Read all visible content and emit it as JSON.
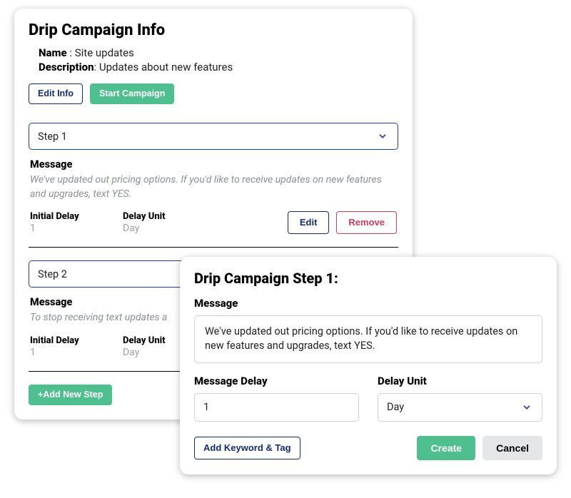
{
  "info": {
    "title": "Drip Campaign Info",
    "name_label": "Name ",
    "name_sep": ": ",
    "name_value": "Site updates",
    "desc_label": "Description",
    "desc_sep": ": ",
    "desc_value": "Updates about new features",
    "edit_info_label": "Edit Info",
    "start_campaign_label": "Start Campaign"
  },
  "steps": [
    {
      "select_label": "Step 1",
      "message_heading": "Message",
      "message_body": "We've updated out pricing options. If you'd like to receive updates on new features and upgrades, text YES.",
      "initial_delay_label": "Initial Delay",
      "initial_delay_value": "1",
      "delay_unit_label": "Delay Unit",
      "delay_unit_value": "Day",
      "edit_label": "Edit",
      "remove_label": "Remove"
    },
    {
      "select_label": "Step 2",
      "message_heading": "Message",
      "message_body": "To stop receiving text updates a",
      "initial_delay_label": "Initial Delay",
      "initial_delay_value": "1",
      "delay_unit_label": "Delay Unit",
      "delay_unit_value": "Day"
    }
  ],
  "add_step_label": "+Add New Step",
  "edit_panel": {
    "title": "Drip Campaign Step 1:",
    "message_heading": "Message",
    "message_value": "We've updated out pricing options. If you'd like to receive updates on new features and upgrades, text YES.",
    "delay_label": "Message Delay",
    "delay_value": "1",
    "unit_label": "Delay Unit",
    "unit_value": "Day",
    "add_keyword_label": "Add Keyword & Tag",
    "create_label": "Create",
    "cancel_label": "Cancel"
  }
}
